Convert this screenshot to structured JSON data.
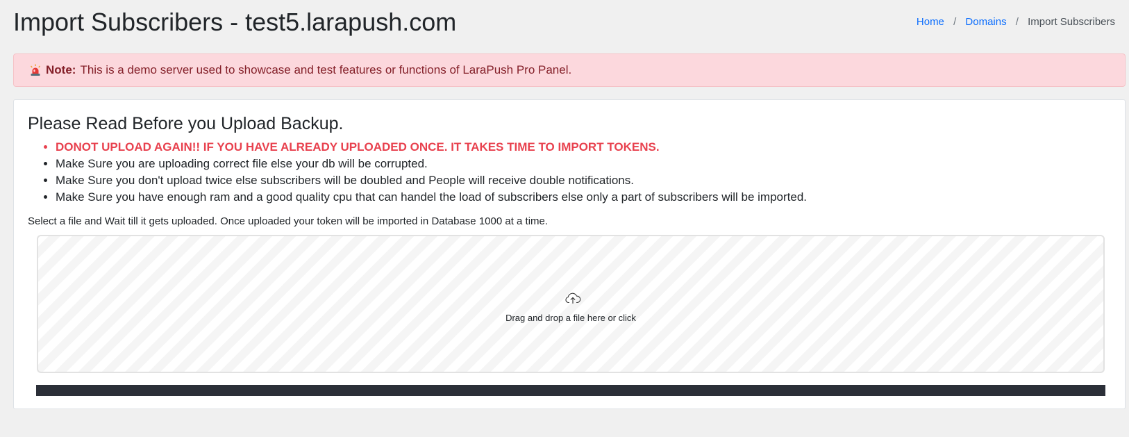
{
  "header": {
    "title": "Import Subscribers - test5.larapush.com"
  },
  "breadcrumb": {
    "items": [
      "Home",
      "Domains",
      "Import Subscribers"
    ],
    "separator": "/"
  },
  "alert": {
    "icon": "siren-icon",
    "label": "Note:",
    "message": "This is a demo server used to showcase and test features or functions of LaraPush Pro Panel."
  },
  "card": {
    "heading": "Please Read Before you Upload Backup.",
    "rules": [
      "DONOT UPLOAD AGAIN!! IF YOU HAVE ALREADY UPLOADED ONCE. IT TAKES TIME TO IMPORT TOKENS.",
      "Make Sure you are uploading correct file else your db will be corrupted.",
      "Make Sure you don't upload twice else subscribers will be doubled and People will receive double notifications.",
      "Make Sure you have enough ram and a good quality cpu that can handel the load of subscribers else only a part of subscribers will be imported."
    ],
    "instructions": "Select a file and Wait till it gets uploaded. Once uploaded your token will be imported in Database 1000 at a time."
  },
  "dropzone": {
    "icon": "cloud-upload-icon",
    "message": "Drag and drop a file here or click"
  },
  "colors": {
    "alert_background": "#fcd8dd",
    "alert_text": "#842029",
    "warning_text": "#e8414e",
    "link": "#0d6efd",
    "upload_bar": "#2b2f38"
  }
}
